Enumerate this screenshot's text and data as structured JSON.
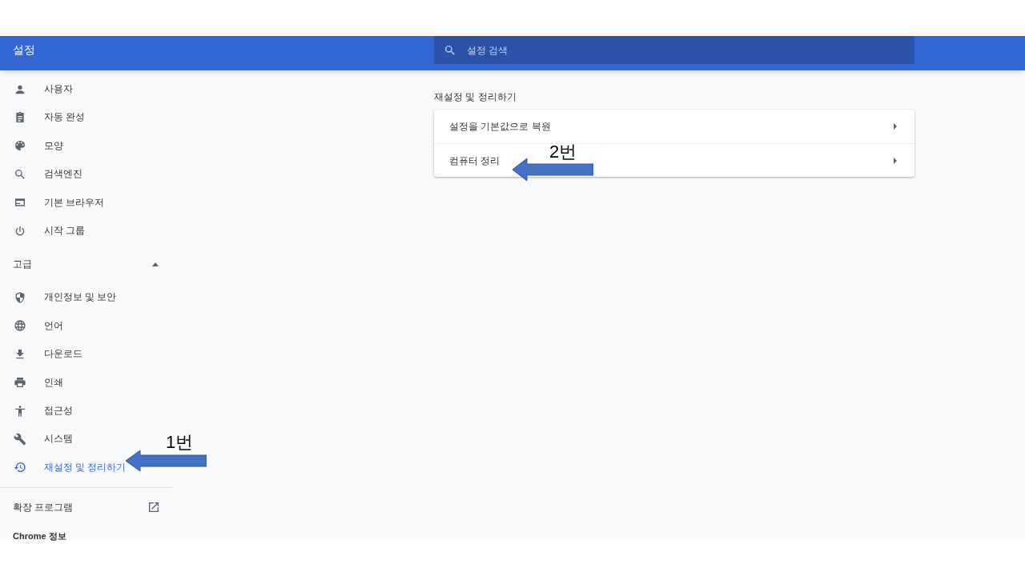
{
  "header": {
    "title": "설정",
    "search": {
      "placeholder": "설정 검색"
    }
  },
  "sidebar": {
    "items": [
      {
        "label": "사용자",
        "selected": false
      },
      {
        "label": "자동 완성",
        "selected": false
      },
      {
        "label": "모양",
        "selected": false
      },
      {
        "label": "검색엔진",
        "selected": false
      },
      {
        "label": "기본 브라우저",
        "selected": false
      },
      {
        "label": "시작 그룹",
        "selected": false
      }
    ],
    "advanced": {
      "label": "고급",
      "expanded": true,
      "items": [
        {
          "label": "개인정보 및 보안",
          "selected": false
        },
        {
          "label": "언어",
          "selected": false
        },
        {
          "label": "다운로드",
          "selected": false
        },
        {
          "label": "인쇄",
          "selected": false
        },
        {
          "label": "접근성",
          "selected": false
        },
        {
          "label": "시스템",
          "selected": false
        },
        {
          "label": "재설정 및 정리하기",
          "selected": true
        }
      ]
    },
    "extensions": "확장 프로그램",
    "about": "Chrome 정보"
  },
  "section": {
    "title": "재설정 및 정리하기",
    "rows": [
      "설정을 기본값으로 복원",
      "컴퓨터 정리"
    ]
  },
  "annotations": [
    {
      "label": "1번"
    },
    {
      "label": "2번"
    }
  ]
}
